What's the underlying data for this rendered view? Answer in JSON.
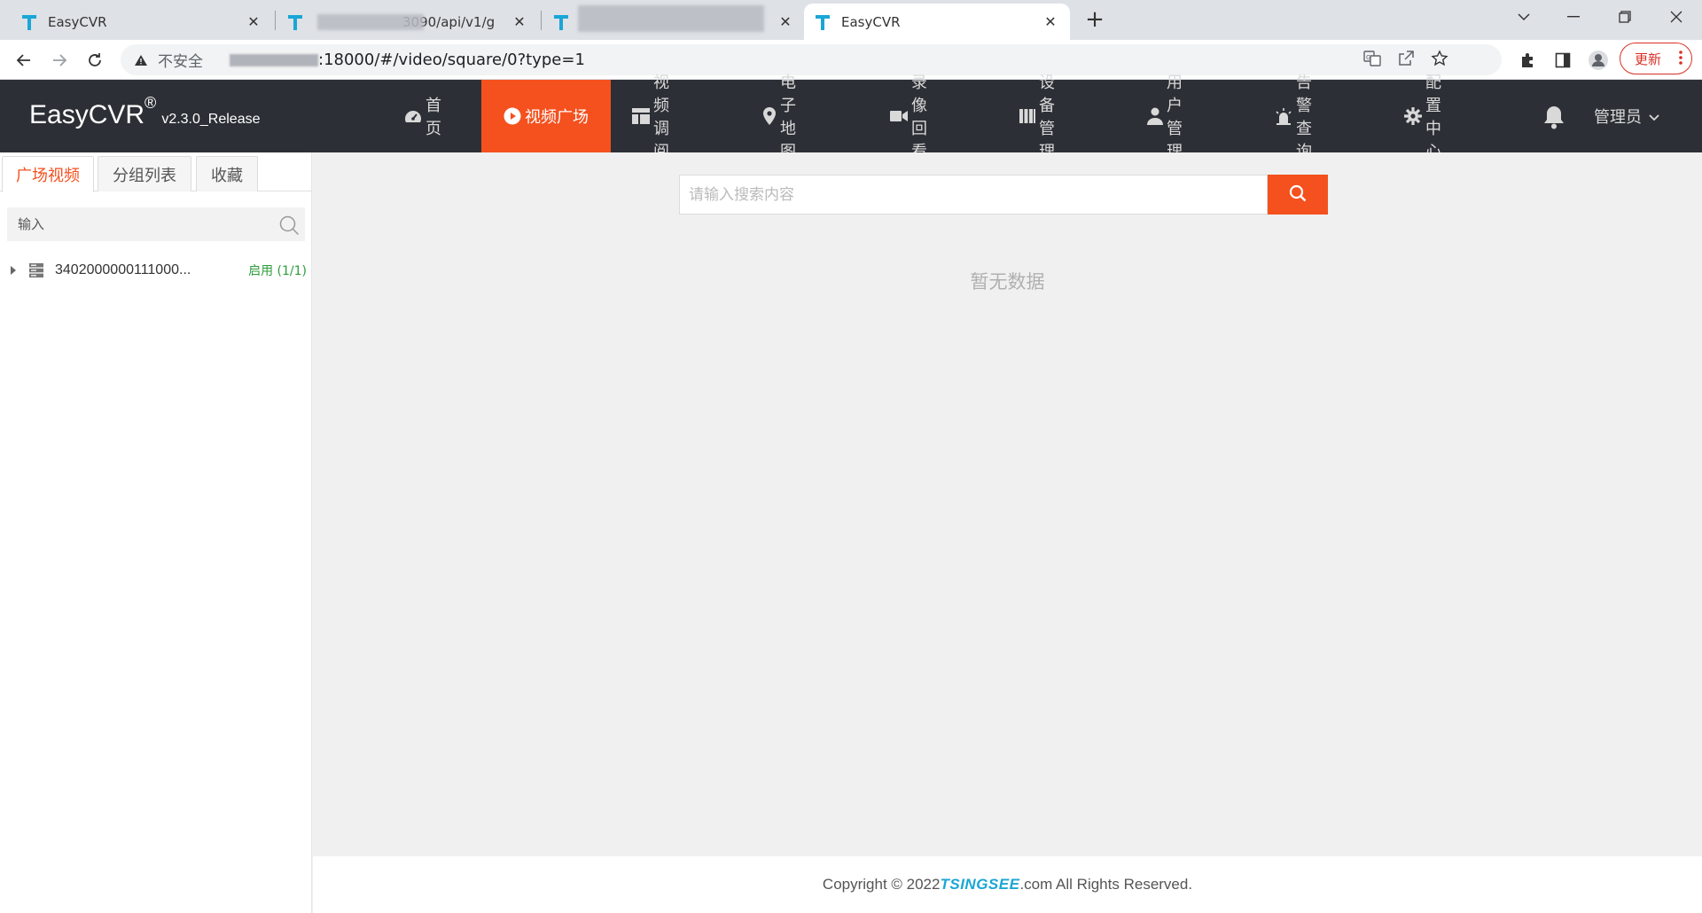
{
  "browser": {
    "tabs": [
      {
        "title": "EasyCVR"
      },
      {
        "title": "3090/api/v1/g"
      },
      {
        "title": ""
      },
      {
        "title": "EasyCVR"
      }
    ],
    "insecure_label": "不安全",
    "url": ":18000/#/video/square/0?type=1",
    "update_label": "更新"
  },
  "app": {
    "brand": "EasyCVR",
    "brand_mark": "®",
    "version": "v2.3.0_Release",
    "nav": [
      {
        "label": "首页",
        "icon": "dashboard-icon"
      },
      {
        "label": "视频广场",
        "icon": "play-circle-icon",
        "active": true
      },
      {
        "label": "视频调阅",
        "icon": "layout-icon"
      },
      {
        "label": "电子地图",
        "icon": "map-pin-icon"
      },
      {
        "label": "录像回看",
        "icon": "video-camera-icon"
      },
      {
        "label": "设备管理",
        "icon": "device-icon"
      },
      {
        "label": "用户管理",
        "icon": "user-icon"
      },
      {
        "label": "告警查询",
        "icon": "alarm-icon"
      },
      {
        "label": "配置中心",
        "icon": "gear-icon"
      }
    ],
    "user": "管理员"
  },
  "sidebar": {
    "tabs": [
      "广场视频",
      "分组列表",
      "收藏"
    ],
    "filter_placeholder": "输入",
    "tree": [
      {
        "label": "3402000000111000...",
        "status": "启用 (1/1)"
      }
    ]
  },
  "main": {
    "search_placeholder": "请输入搜索内容",
    "empty_text": "暂无数据"
  },
  "footer": {
    "prefix": "Copyright © 2022 ",
    "brand": "TSINGSEE",
    "suffix": ".com All Rights Reserved."
  },
  "colors": {
    "accent": "#f4511e",
    "header_bg": "#2c3036",
    "status_green": "#2e9d3b"
  }
}
